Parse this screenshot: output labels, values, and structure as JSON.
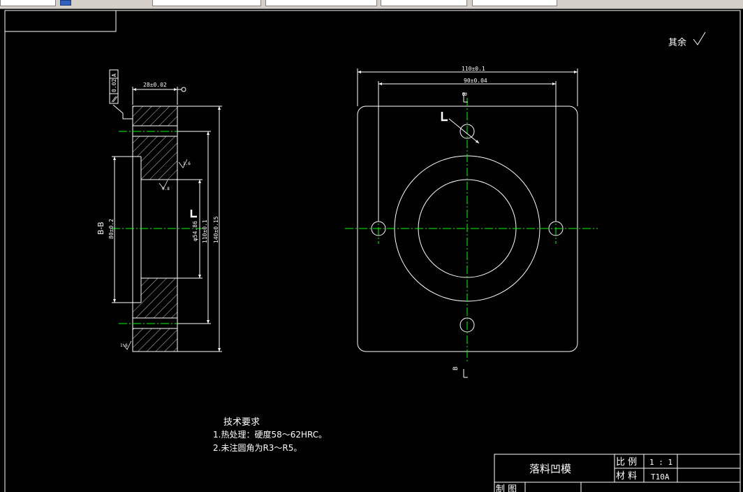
{
  "window": {
    "top_fields": [
      "",
      "",
      "",
      ""
    ]
  },
  "drawing": {
    "surface_note": "其余",
    "section_label": "B-B",
    "view_mark_top": "B",
    "view_mark_bottom": "B",
    "dims": {
      "flatness": "0.02",
      "datum": "A",
      "thickness": "28±0.02",
      "height_80": "80±0.2",
      "bore": "φ54.86",
      "pitch_110_v": "110±0.1",
      "overall_140": "140±0.15",
      "width_110": "110±0.1",
      "pitch_90": "90±0.04"
    },
    "roughness": [
      "1.6",
      "0.8",
      "1.6"
    ],
    "tech_req": {
      "title": "技术要求",
      "lines": [
        "1.热处理：硬度58～62HRC。",
        "2.未注圆角为R3～R5。"
      ]
    },
    "title_block": {
      "part_name": "落料凹模",
      "scale_label": "比 例",
      "scale_value": "1 : 1",
      "material_label": "材 料",
      "material_value": "T10A",
      "drawn_label": "制 图"
    }
  },
  "colors": {
    "background": "#000000",
    "lines": "#ffffff",
    "centerlines": "#00ff00"
  }
}
